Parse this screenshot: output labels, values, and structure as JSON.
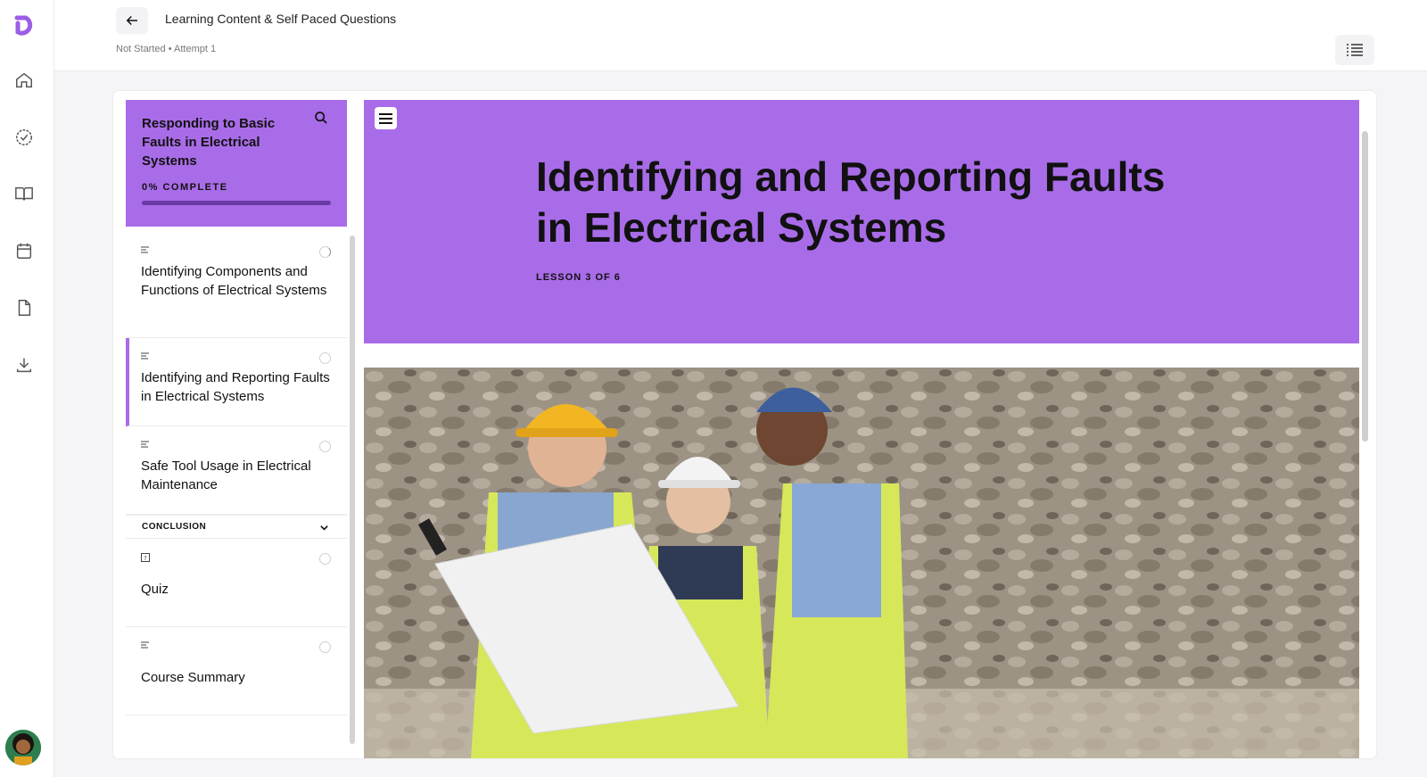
{
  "header": {
    "title": "Learning Content & Self Paced Questions",
    "status": "Not Started • Attempt 1"
  },
  "rail": {
    "items": [
      "home-icon",
      "check-badge-icon",
      "book-icon",
      "calendar-icon",
      "document-icon",
      "download-icon"
    ]
  },
  "sidebar": {
    "course_title": "Responding to Basic Faults in Electrical Systems",
    "progress_label": "0% COMPLETE",
    "progress_fraction": 0.0,
    "lessons": [
      {
        "label": "Identifying Components and Functions of Electrical Systems",
        "icon": "lines-icon"
      },
      {
        "label": "Identifying and Reporting Faults in Electrical Systems",
        "icon": "lines-icon",
        "active": true
      },
      {
        "label": "Safe Tool Usage in Electrical Maintenance",
        "icon": "lines-icon"
      }
    ],
    "section": "CONCLUSION",
    "section_items": [
      {
        "label": "Quiz",
        "icon": "quiz-icon"
      },
      {
        "label": "Course Summary",
        "icon": "lines-icon"
      }
    ]
  },
  "main": {
    "lesson_title": "Identifying and Reporting Faults in Electrical Systems",
    "lesson_count": "LESSON 3 OF 6"
  },
  "colors": {
    "accent": "#a96ce8",
    "logo": "#9b5de5"
  }
}
